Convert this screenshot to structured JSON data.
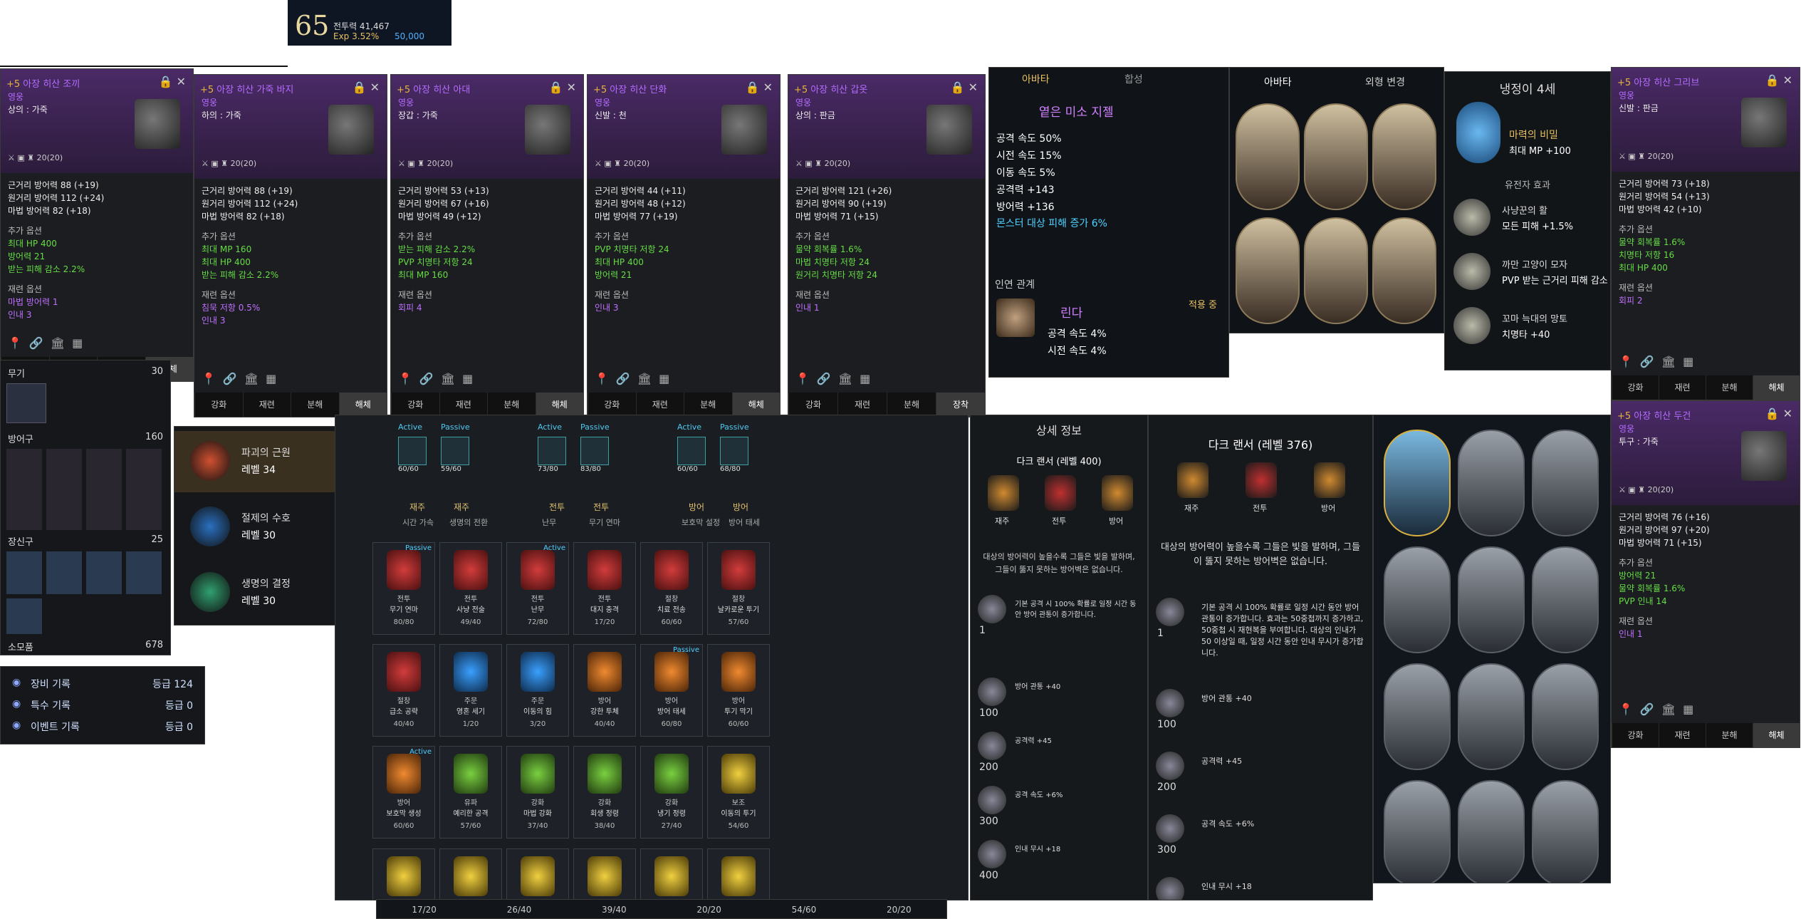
{
  "profile": {
    "level": "65",
    "combat_label": "전투력 41,467",
    "exp": "Exp 3.52%",
    "currency": "50,000"
  },
  "items": [
    {
      "title_prefix": "+5",
      "title": "아장 히산 조끼",
      "grade": "영웅",
      "slot": "상의 : 가죽",
      "dur": "20(20)",
      "stats": [
        "근거리 방어력 88 (+19)",
        "원거리 방어력 112 (+24)",
        "마법 방어력 82 (+18)"
      ],
      "extra_head": "추가 옵션",
      "extra": [
        "최대 HP 400",
        "방어력 21",
        "받는 피해 감소 2.2%"
      ],
      "reforge_head": "재련 옵션",
      "reforge": [
        "마법 방어력 1",
        "인내 3"
      ]
    },
    {
      "title_prefix": "+5",
      "title": "아장 히산 가죽 바지",
      "grade": "영웅",
      "slot": "하의 : 가죽",
      "dur": "20(20)",
      "stats": [
        "근거리 방어력 88 (+19)",
        "원거리 방어력 112 (+24)",
        "마법 방어력 82 (+18)"
      ],
      "extra_head": "추가 옵션",
      "extra": [
        "최대 MP 160",
        "최대 HP 400",
        "받는 피해 감소 2.2%"
      ],
      "reforge_head": "재련 옵션",
      "reforge": [
        "침묵 저항 0.5%",
        "인내 3"
      ]
    },
    {
      "title_prefix": "+5",
      "title": "아장 히산 아대",
      "grade": "영웅",
      "slot": "장갑 : 가죽",
      "dur": "20(20)",
      "stats": [
        "근거리 방어력 53 (+13)",
        "원거리 방어력 67 (+16)",
        "마법 방어력 49 (+12)"
      ],
      "extra_head": "추가 옵션",
      "extra": [
        "받는 피해 감소 2.2%",
        "PVP 치명타 저항 24",
        "최대 MP 160"
      ],
      "reforge_head": "재련 옵션",
      "reforge": [
        "회피 4"
      ]
    },
    {
      "title_prefix": "+5",
      "title": "아장 히산 단화",
      "grade": "영웅",
      "slot": "신발 : 천",
      "dur": "20(20)",
      "stats": [
        "근거리 방어력 44 (+11)",
        "원거리 방어력 48 (+12)",
        "마법 방어력 77 (+19)"
      ],
      "extra_head": "추가 옵션",
      "extra": [
        "PVP 치명타 저항 24",
        "최대 HP 400",
        "방어력 21"
      ],
      "reforge_head": "재련 옵션",
      "reforge": [
        "인내 3"
      ]
    },
    {
      "title_prefix": "+5",
      "title": "아장 히산 갑옷",
      "grade": "영웅",
      "slot": "상의 : 판금",
      "dur": "20(20)",
      "stats": [
        "근거리 방어력 121 (+26)",
        "원거리 방어력 90 (+19)",
        "마법 방어력 71 (+15)"
      ],
      "extra_head": "추가 옵션",
      "extra": [
        "물약 회복률 1.6%",
        "마법 치명타 저항 24",
        "원거리 치명타 저항 24"
      ],
      "reforge_head": "재련 옵션",
      "reforge": [
        "인내 1"
      ]
    },
    {
      "title_prefix": "+5",
      "title": "아장 히산 그리브",
      "grade": "영웅",
      "slot": "신발 : 판금",
      "dur": "20(20)",
      "stats": [
        "근거리 방어력 73 (+18)",
        "원거리 방어력 54 (+13)",
        "마법 방어력 42 (+10)"
      ],
      "extra_head": "추가 옵션",
      "extra": [
        "물약 회복률 1.6%",
        "치명타 저항 16",
        "최대 HP 400"
      ],
      "reforge_head": "재련 옵션",
      "reforge": [
        "회피 2"
      ]
    },
    {
      "title_prefix": "+5",
      "title": "아장 히산 두건",
      "grade": "영웅",
      "slot": "투구 : 가죽",
      "dur": "20(20)",
      "stats": [
        "근거리 방어력 76 (+16)",
        "원거리 방어력 97 (+20)",
        "마법 방어력 71 (+15)"
      ],
      "extra_head": "추가 옵션",
      "extra": [
        "방어력 21",
        "물약 회복률 1.6%",
        "PVP 인내 14"
      ],
      "reforge_head": "재련 옵션",
      "reforge": [
        "인내 1"
      ]
    }
  ],
  "item_tabs": [
    "강화",
    "재련",
    "분해",
    "해체"
  ],
  "item_tabs_alt": [
    "강화",
    "재련",
    "분해",
    "장착"
  ],
  "equip_summary": {
    "weapon_label": "무기",
    "weapon_val": "30",
    "armor_label": "방어구",
    "armor_val": "160",
    "acc_label": "장신구",
    "acc_val": "25",
    "cons_label": "소모품",
    "cons_val": "678"
  },
  "records": [
    {
      "label": "장비 기록",
      "grade": "등급 124"
    },
    {
      "label": "특수 기록",
      "grade": "등급 0"
    },
    {
      "label": "이벤트 기록",
      "grade": "등급 0"
    }
  ],
  "runes": [
    {
      "name": "파괴의 근원",
      "level": "레벨 34"
    },
    {
      "name": "절제의 수호",
      "level": "레벨 30"
    },
    {
      "name": "생명의 결정",
      "level": "레벨 30"
    }
  ],
  "avatar_panel": {
    "tab1": "아바타",
    "tab2": "합성",
    "item_name": "옅은 미소 지젤",
    "stats": [
      "공격 속도 50%",
      "시전 속도 15%",
      "이동 속도 5%",
      "공격력 +143",
      "방어력 +136"
    ],
    "special": "몬스터 대상 피해 증가 6%",
    "relation_head": "인연 관계",
    "relation_name": "린다",
    "relation_state": "적용 중",
    "relation_stats": [
      "공격 속도 4%",
      "시전 속도 4%"
    ]
  },
  "avatar_grid": {
    "tab1": "아바타",
    "tab2": "외형 변경"
  },
  "pet": {
    "title": "냉정이 4세",
    "buff_name": "마력의 비밀",
    "buff_val": "최대 MP +100",
    "inherit_head": "유전자 효과",
    "genes": [
      {
        "name": "사냥꾼의 활",
        "val": "모든 피해 +1.5%"
      },
      {
        "name": "까만 고양이 모자",
        "val": "PVP 받는 근거리 피해 감소"
      },
      {
        "name": "꼬마 늑대의 망토",
        "val": "치명타 +40"
      }
    ]
  },
  "skill_tree": {
    "headers": [
      {
        "a": "Active",
        "b": "Passive",
        "v1": "60/60",
        "v2": "59/60"
      },
      {
        "a": "Active",
        "b": "Passive",
        "v1": "73/80",
        "v2": "83/80"
      },
      {
        "a": "Active",
        "b": "Passive",
        "v1": "60/60",
        "v2": "68/80"
      }
    ],
    "cats": [
      {
        "t1": "재주",
        "t2": "재주",
        "s1": "시간 가속",
        "s2": "생명의 전환"
      },
      {
        "t1": "전투",
        "t2": "전투",
        "s1": "난무",
        "s2": "무기 연마"
      },
      {
        "t1": "방어",
        "t2": "방어",
        "s1": "보호막 설정",
        "s2": "방어 태세"
      }
    ],
    "row1": [
      {
        "c": "red",
        "t1": "전투",
        "t2": "무기 연마",
        "v": "80/80",
        "tag": "Passive"
      },
      {
        "c": "red",
        "t1": "전투",
        "t2": "사냥 전술",
        "v": "49/40",
        "tag": ""
      },
      {
        "c": "red",
        "t1": "전투",
        "t2": "난무",
        "v": "72/80",
        "tag": "Active"
      },
      {
        "c": "red",
        "t1": "전투",
        "t2": "대지 충격",
        "v": "17/20",
        "tag": ""
      },
      {
        "c": "red",
        "t1": "절창",
        "t2": "치료 전송",
        "v": "60/60",
        "tag": ""
      },
      {
        "c": "red",
        "t1": "절창",
        "t2": "날카로운 투기",
        "v": "57/60",
        "tag": ""
      }
    ],
    "row2": [
      {
        "c": "red",
        "t1": "절창",
        "t2": "급소 공략",
        "v": "40/40",
        "tag": ""
      },
      {
        "c": "blue",
        "t1": "주문",
        "t2": "영혼 세기",
        "v": "1/20",
        "tag": ""
      },
      {
        "c": "blue",
        "t1": "주문",
        "t2": "이동의 힘",
        "v": "3/20",
        "tag": ""
      },
      {
        "c": "orange",
        "t1": "방어",
        "t2": "강한 투체",
        "v": "40/40",
        "tag": ""
      },
      {
        "c": "orange",
        "t1": "방어",
        "t2": "방어 태세",
        "v": "60/80",
        "tag": "Passive"
      },
      {
        "c": "orange",
        "t1": "방어",
        "t2": "투기 막기",
        "v": "60/60",
        "tag": ""
      }
    ],
    "row3": [
      {
        "c": "orange",
        "t1": "방어",
        "t2": "보호막 생성",
        "v": "60/60",
        "tag": "Active"
      },
      {
        "c": "green",
        "t1": "유파",
        "t2": "예리한 공격",
        "v": "57/60",
        "tag": ""
      },
      {
        "c": "green",
        "t1": "강화",
        "t2": "마법 강화",
        "v": "37/40",
        "tag": ""
      },
      {
        "c": "green",
        "t1": "강화",
        "t2": "회생 정령",
        "v": "38/40",
        "tag": ""
      },
      {
        "c": "green",
        "t1": "강화",
        "t2": "냉기 정령",
        "v": "27/40",
        "tag": ""
      },
      {
        "c": "gold",
        "t1": "보조",
        "t2": "이동의 투기",
        "v": "54/60",
        "tag": ""
      }
    ],
    "bottom": [
      "17/20",
      "26/40",
      "39/40",
      "20/20",
      "54/60",
      "20/20"
    ]
  },
  "detail_small": {
    "title": "상세 정보",
    "sub": "다크 랜서 (레벨 400)",
    "icons": [
      "재주",
      "전투",
      "방어"
    ],
    "desc": "대상의 방어력이 높을수록 그들은 빛을 발하며, 그들이 뚫지 못하는 방어벽은 없습니다.",
    "tiers": [
      {
        "n": "1",
        "v": "기본 공격 시 100% 확률로 일정 시간 동안 방어 관통이 증가합니다."
      },
      {
        "n": "100",
        "v": "방어 관통 +40"
      },
      {
        "n": "200",
        "v": "공격력 +45"
      },
      {
        "n": "300",
        "v": "공격 속도 +6%"
      },
      {
        "n": "400",
        "v": "인내 무시 +18"
      }
    ]
  },
  "detail_big": {
    "sub": "다크 랜서 (레벨 376)",
    "icons": [
      "재주",
      "전투",
      "방어"
    ],
    "desc": "대상의 방어력이 높을수록 그들은 빛을 발하며, 그들이 뚫지 못하는 방어벽은 없습니다.",
    "tiers": [
      {
        "n": "1",
        "v": "기본 공격 시 100% 확률로 일정 시간 동안 방어 관통이 증가합니다. 효과는 50중첩까지 증가하고, 50중첩 시 재현복을 부여합니다. 대상의 인내가 50 이상일 때, 일정 시간 동안 인내 무시가 증가합니다."
      },
      {
        "n": "100",
        "v": "방어 관통 +40"
      },
      {
        "n": "200",
        "v": "공격력 +45"
      },
      {
        "n": "300",
        "v": "공격 속도 +6%"
      },
      {
        "n": "400",
        "v": "인내 무시 +18"
      }
    ]
  }
}
